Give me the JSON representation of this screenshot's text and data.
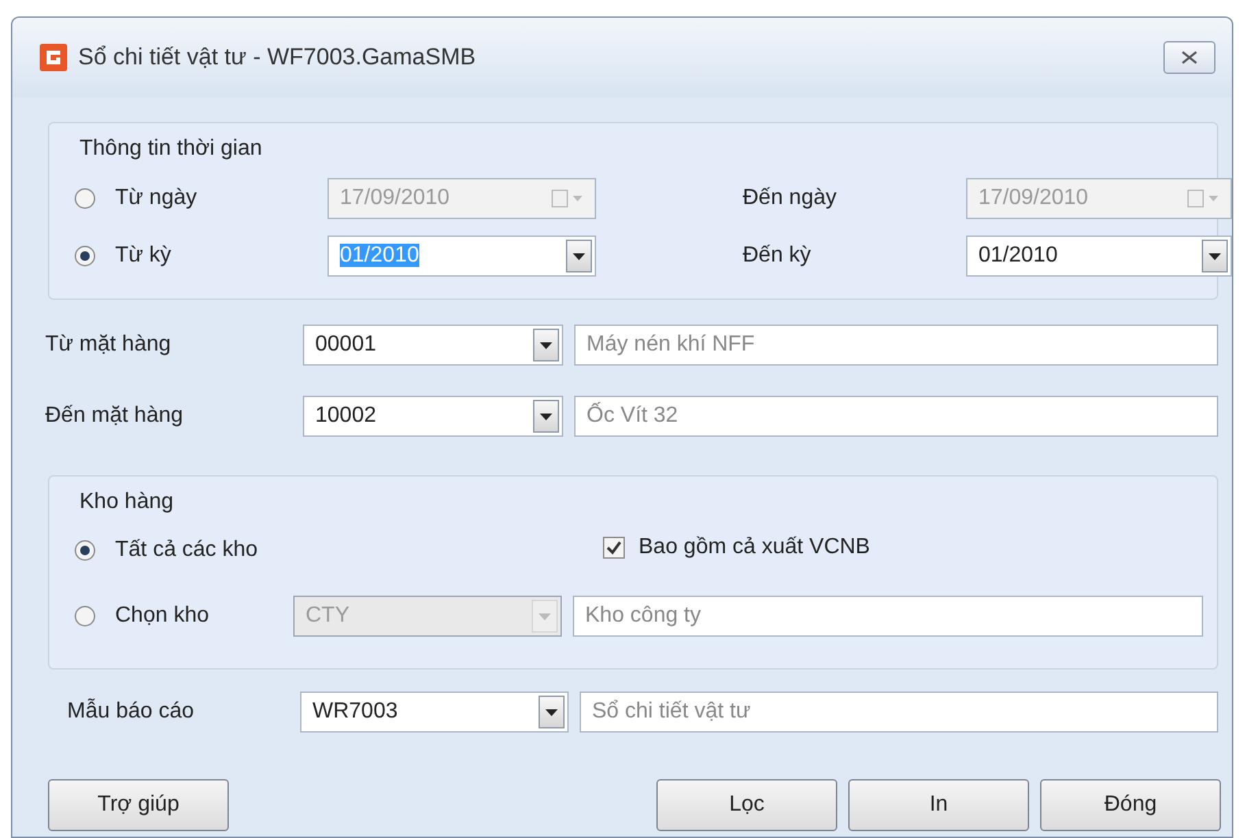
{
  "window": {
    "title": "Sổ chi tiết vật tư - WF7003.GamaSMB"
  },
  "time_group": {
    "title": "Thông tin thời gian",
    "rows": [
      {
        "kind": "date",
        "label": "Từ ngày",
        "selected": false,
        "disabled": true,
        "value": "17/09/2010",
        "text_selected": false,
        "end_label": "Đến ngày",
        "end_value": "17/09/2010"
      },
      {
        "kind": "period",
        "label": "Từ kỳ",
        "selected": true,
        "disabled": false,
        "value": "01/2010",
        "text_selected": true,
        "end_label": "Đến kỳ",
        "end_value": "01/2010"
      }
    ]
  },
  "items": [
    {
      "label": "Từ mặt hàng",
      "code": "00001",
      "description": "Máy nén khí NFF"
    },
    {
      "label": "Đến mặt hàng",
      "code": "10002",
      "description": "Ốc Vít 32"
    }
  ],
  "warehouse_group": {
    "title": "Kho hàng",
    "options": [
      {
        "label": "Tất cả các kho",
        "selected": true
      },
      {
        "label": "Chọn kho",
        "selected": false,
        "disabled": true,
        "code": "CTY",
        "description": "Kho công ty"
      }
    ],
    "include_transfer": {
      "label": "Bao gồm cả xuất VCNB",
      "checked": true
    }
  },
  "report_template": {
    "label": "Mẫu báo cáo",
    "code": "WR7003",
    "description": "Sổ chi tiết vật tư"
  },
  "help_button": {
    "label": "Trợ giúp"
  },
  "action_buttons": [
    {
      "label": "Lọc"
    },
    {
      "label": "In"
    },
    {
      "label": "Đóng"
    }
  ]
}
